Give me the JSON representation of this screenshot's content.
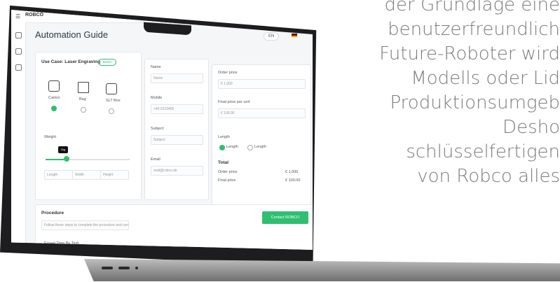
{
  "copy_lines": [
    "der Grundlage eine",
    "benutzerfreundlich",
    "Future-Roboter wird",
    "Modells oder Lid",
    "Produktionsumgeb",
    "Desho",
    "schlüsselfertigen",
    "von Robco alles"
  ],
  "app": {
    "brand": "ROBCO",
    "title": "Automation Guide",
    "lang": "EN",
    "card1": {
      "heading": "Use Case: Laser Engraving",
      "pill": "Switch",
      "options": [
        "Carton",
        "Bag",
        "SLT Box"
      ],
      "weight_label": "Weight",
      "weight_tip": "1kg",
      "dims": [
        "Length",
        "Width",
        "Height"
      ]
    },
    "card2": {
      "fields": [
        {
          "label": "Name",
          "value": "Name"
        },
        {
          "label": "Mobile",
          "value": "+49 0123456"
        },
        {
          "label": "Subject",
          "value": "Subject"
        },
        {
          "label": "Email",
          "value": "mail@robco.de"
        }
      ]
    },
    "card3": {
      "fields": [
        {
          "label": "Order price",
          "value": "€ 1,000"
        },
        {
          "label": "Final price per unit",
          "value": "€ 100.00"
        }
      ],
      "length_label": "Length",
      "length_opts": [
        "Length",
        "Length"
      ],
      "total_label": "Total",
      "rows": [
        {
          "k": "Order price",
          "v": "€ 1,000"
        },
        {
          "k": "Final price",
          "v": "€ 100.00"
        }
      ],
      "cta": "Contact ROBCO"
    },
    "procedure": {
      "heading": "Procedure",
      "desc": "Follow these steps to complete the procedure and connect your robot",
      "sub": "Expert Time By Task"
    }
  }
}
